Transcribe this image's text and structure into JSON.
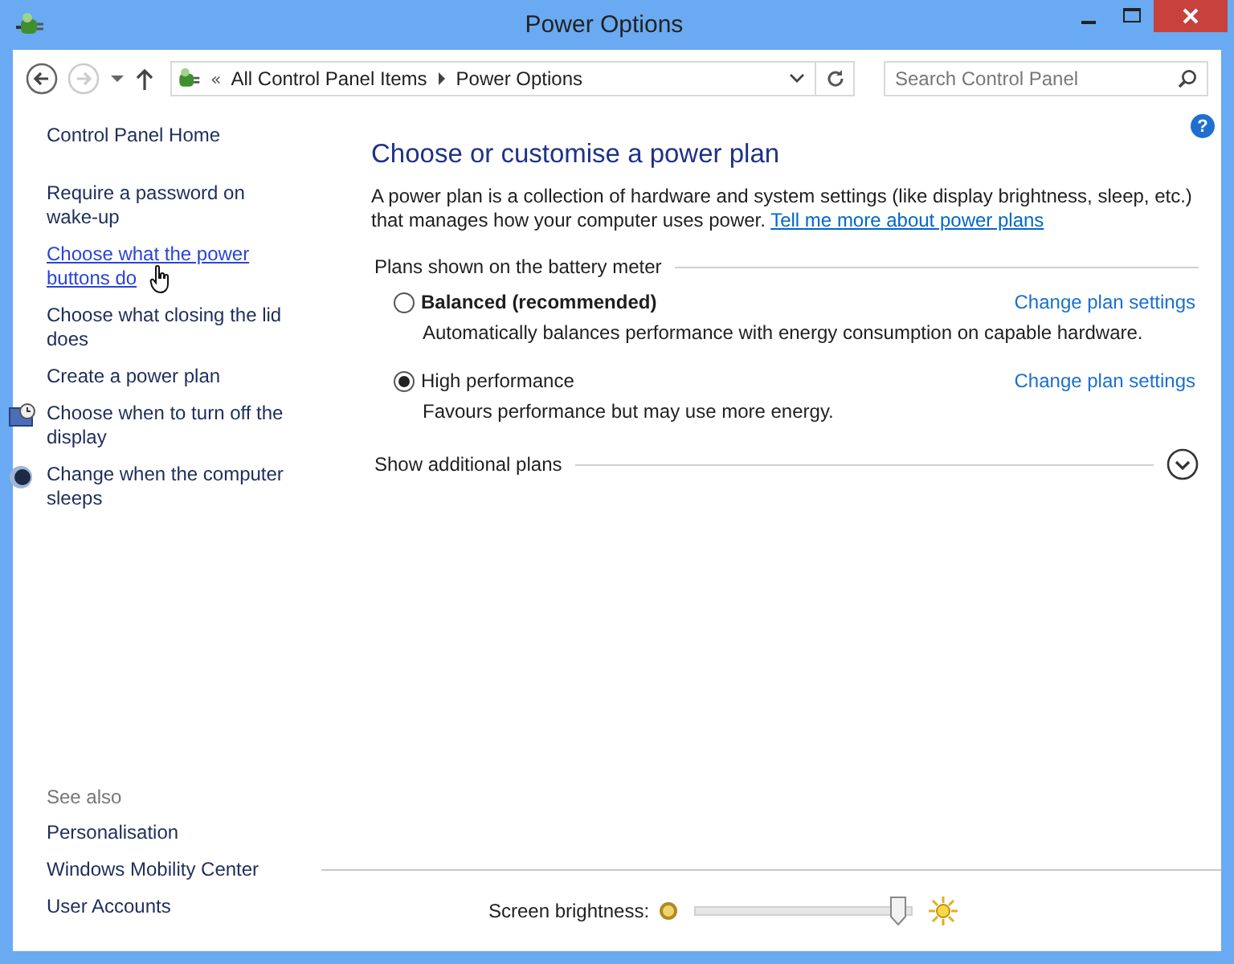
{
  "window": {
    "title": "Power Options"
  },
  "address_bar": {
    "separator": "«",
    "crumbs": [
      "All Control Panel Items",
      "Power Options"
    ]
  },
  "search": {
    "placeholder": "Search Control Panel"
  },
  "sidebar": {
    "home": "Control Panel Home",
    "items": [
      {
        "label": "Require a password on wake-up",
        "kind": "plain",
        "hovered": false
      },
      {
        "label": "Choose what the power buttons do",
        "kind": "plain",
        "hovered": true
      },
      {
        "label": "Choose what closing the lid does",
        "kind": "plain",
        "hovered": false
      },
      {
        "label": "Create a power plan",
        "kind": "plain",
        "hovered": false
      },
      {
        "label": "Choose when to turn off the display",
        "kind": "display",
        "hovered": false
      },
      {
        "label": "Change when the computer sleeps",
        "kind": "sleep",
        "hovered": false
      }
    ],
    "see_also": {
      "title": "See also",
      "items": [
        "Personalisation",
        "Windows Mobility Center",
        "User Accounts"
      ]
    }
  },
  "main": {
    "heading": "Choose or customise a power plan",
    "description": "A power plan is a collection of hardware and system settings (like display brightness, sleep, etc.) that manages how your computer uses power.",
    "description_link": "Tell me more about power plans",
    "group_title": "Plans shown on the battery meter",
    "plans": [
      {
        "name": "Balanced (recommended)",
        "bold": true,
        "selected": false,
        "description": "Automatically balances performance with energy consumption on capable hardware.",
        "link": "Change plan settings"
      },
      {
        "name": "High performance",
        "bold": false,
        "selected": true,
        "description": "Favours performance but may use more energy.",
        "link": "Change plan settings"
      }
    ],
    "additional": "Show additional plans",
    "help": "?"
  },
  "brightness": {
    "label": "Screen brightness:",
    "level": 0.97
  }
}
